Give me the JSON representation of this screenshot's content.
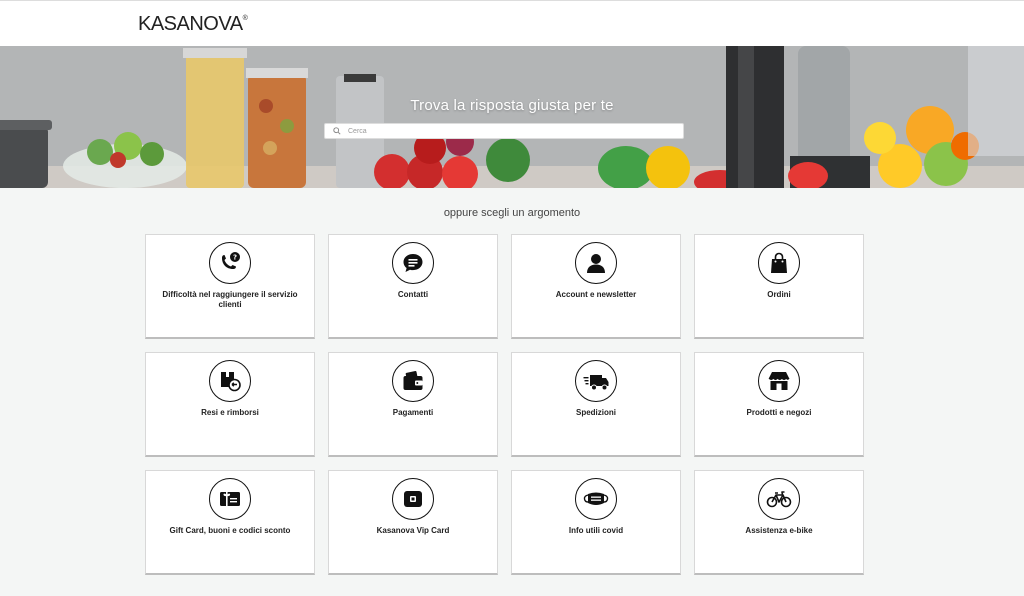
{
  "header": {
    "logo_text": "KASANOVA",
    "logo_mark": "®"
  },
  "hero": {
    "title": "Trova la risposta giusta per te",
    "search_placeholder": "Cerca",
    "search_value": ""
  },
  "main": {
    "subtitle": "oppure scegli un argomento",
    "topics": [
      {
        "label": "Difficoltà nel raggiungere il servizio clienti",
        "icon": "phone-question-icon"
      },
      {
        "label": "Contatti",
        "icon": "chat-bubble-icon"
      },
      {
        "label": "Account e newsletter",
        "icon": "user-icon"
      },
      {
        "label": "Ordini",
        "icon": "shopping-bag-icon"
      },
      {
        "label": "Resi e rimborsi",
        "icon": "return-box-icon"
      },
      {
        "label": "Pagamenti",
        "icon": "wallet-icon"
      },
      {
        "label": "Spedizioni",
        "icon": "delivery-truck-icon"
      },
      {
        "label": "Prodotti e negozi",
        "icon": "store-icon"
      },
      {
        "label": "Gift Card, buoni e codici sconto",
        "icon": "gift-card-icon"
      },
      {
        "label": "Kasanova Vip Card",
        "icon": "vip-card-icon"
      },
      {
        "label": "Info utili covid",
        "icon": "face-mask-icon"
      },
      {
        "label": "Assistenza e-bike",
        "icon": "bicycle-icon"
      }
    ]
  }
}
